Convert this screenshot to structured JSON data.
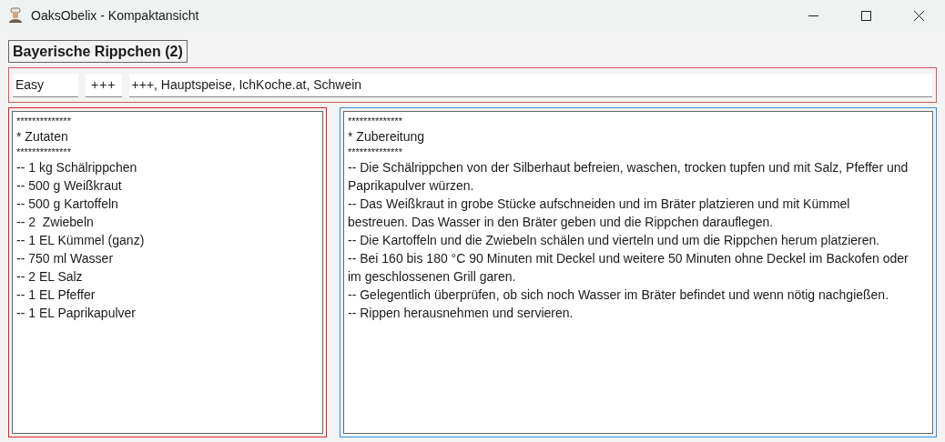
{
  "window": {
    "title": "OaksObelix - Kompaktansicht"
  },
  "recipe_title": "Bayerische Rippchen (2)",
  "meta": {
    "difficulty": "Easy",
    "rating_button": "+++",
    "tags": "+++, Hauptspeise, IchKoche.at, Schwein"
  },
  "ingredients": [
    {
      "kind": "rule",
      "text": "**************"
    },
    {
      "kind": "line",
      "text": "* Zutaten"
    },
    {
      "kind": "rule",
      "text": "**************"
    },
    {
      "kind": "line",
      "text": "-- 1 kg Schälrippchen"
    },
    {
      "kind": "line",
      "text": "-- 500 g Weißkraut"
    },
    {
      "kind": "line",
      "text": "-- 500 g Kartoffeln"
    },
    {
      "kind": "line",
      "text": "-- 2  Zwiebeln"
    },
    {
      "kind": "line",
      "text": "-- 1 EL Kümmel (ganz)"
    },
    {
      "kind": "line",
      "text": "-- 750 ml Wasser"
    },
    {
      "kind": "line",
      "text": "-- 2 EL Salz"
    },
    {
      "kind": "line",
      "text": "-- 1 EL Pfeffer"
    },
    {
      "kind": "line",
      "text": "-- 1 EL Paprikapulver"
    }
  ],
  "preparation": [
    {
      "kind": "rule",
      "text": "**************"
    },
    {
      "kind": "line",
      "text": "* Zubereitung"
    },
    {
      "kind": "rule",
      "text": "**************"
    },
    {
      "kind": "line",
      "text": "-- Die Schälrippchen von der Silberhaut befreien, waschen, trocken tupfen und mit Salz, Pfeffer und Paprikapulver würzen."
    },
    {
      "kind": "line",
      "text": "-- Das Weißkraut in grobe Stücke aufschneiden und im Bräter platzieren und mit Kümmel bestreuen. Das Wasser in den Bräter geben und die Rippchen darauflegen."
    },
    {
      "kind": "line",
      "text": "-- Die Kartoffeln und die Zwiebeln schälen und vierteln und um die Rippchen herum platzieren."
    },
    {
      "kind": "line",
      "text": "-- Bei 160 bis 180 °C 90 Minuten mit Deckel und weitere 50 Minuten ohne Deckel im Backofen oder im geschlossenen Grill garen."
    },
    {
      "kind": "line",
      "text": "-- Gelegentlich überprüfen, ob sich noch Wasser im Bräter befindet und wenn nötig nachgießen."
    },
    {
      "kind": "line",
      "text": "-- Rippen herausnehmen und servieren."
    }
  ]
}
